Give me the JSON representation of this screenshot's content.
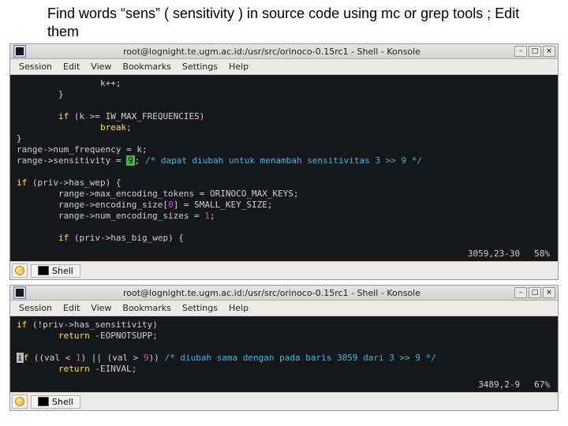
{
  "slide": {
    "title": "Find words  “sens” ( sensitivity ) in source code using mc or grep tools ; Edit them"
  },
  "win_top": {
    "title": "root@lognight.te.ugm.ac.id:/usr/src/orinoco-0.15rc1 - Shell - Konsole",
    "menus": [
      "Session",
      "Edit",
      "View",
      "Bookmarks",
      "Settings",
      "Help"
    ],
    "tab_label": "Shell",
    "status": {
      "pos": "3059,23-30",
      "pct": "58%"
    },
    "code": {
      "l1": "                k++;",
      "l2": "        }",
      "l3": "",
      "l4a": "        ",
      "l4b": "if",
      "l4c": " (k >= IW_MAX_FREQUENCIES)",
      "l5a": "                ",
      "l5b": "break",
      "l5c": ";",
      "l6": "}",
      "l7": "range->num_frequency = k;",
      "l8a": "range->sensitivity = ",
      "l8cur": "9",
      "l8b": "; ",
      "l8cmt": "/* dapat diubah untuk menambah sensitivitas 3 >> 9 */",
      "l9": "",
      "l10a": "if",
      "l10b": " (priv->has_wep) {",
      "l11": "        range->max_encoding_tokens = ORINOCO_MAX_KEYS;",
      "l12a": "        range->encoding_size[",
      "l12b": "0",
      "l12c": "] = SMALL_KEY_SIZE;",
      "l13a": "        range->num_encoding_sizes = ",
      "l13b": "1",
      "l13c": ";",
      "l14": "",
      "l15a": "        ",
      "l15b": "if",
      "l15c": " (priv->has_big_wep) {"
    }
  },
  "win_bot": {
    "title": "root@lognight.te.ugm.ac.id:/usr/src/orinoco-0.15rc1 - Shell - Konsole",
    "menus": [
      "Session",
      "Edit",
      "View",
      "Bookmarks",
      "Settings",
      "Help"
    ],
    "tab_label": "Shell",
    "status": {
      "pos": "3489,2-9",
      "pct": "67%"
    },
    "code": {
      "l1a": "if",
      "l1b": " (!priv->has_sensitivity)",
      "l2a": "        ",
      "l2b": "return",
      "l2c": " -EOPNOTSUPP;",
      "l3": "",
      "l4pre": "i",
      "l4a": "f",
      "l4b": " ((val < ",
      "l4c": "1",
      "l4d": ") || (val > ",
      "l4e": "9",
      "l4f": ")) ",
      "l4cmt": "/* diubah sama dengan pada baris 3059 dari 3 >> 9 */",
      "l5a": "        ",
      "l5b": "return",
      "l5c": " -EINVAL;"
    }
  },
  "winbtns": {
    "min": "–",
    "max": "□",
    "close": "×"
  }
}
